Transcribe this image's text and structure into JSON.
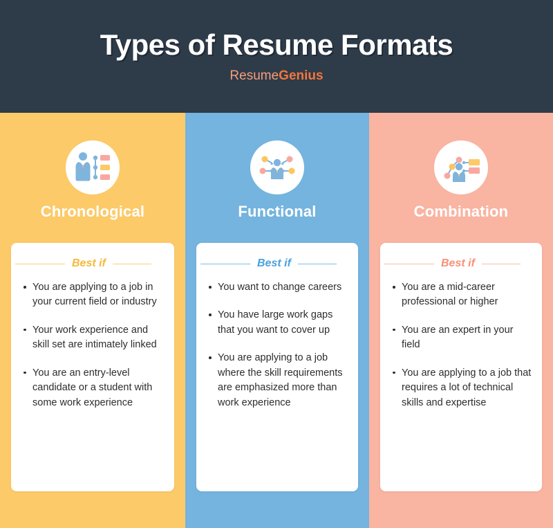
{
  "header": {
    "title": "Types of Resume Formats",
    "logo_first": "Resume",
    "logo_second": "Genius",
    "background_color": "#2e3b49",
    "logo_first_color": "#f79e78",
    "logo_second_color": "#f4763c"
  },
  "columns": [
    {
      "title": "Chronological",
      "background_color": "#fcca69",
      "accent_color": "#f7b939",
      "icon_name": "person-timeline-icon",
      "best_if_label": "Best if",
      "bullets": [
        "You are applying to a job in your current field or industry",
        "Your work experience and skill set are intimately linked",
        "You are an entry-level candidate or a student with some work experience"
      ]
    },
    {
      "title": "Functional",
      "background_color": "#74b4de",
      "accent_color": "#49a2de",
      "icon_name": "person-skills-network-icon",
      "best_if_label": "Best if",
      "bullets": [
        "You want to change careers",
        "You have large work gaps that you want to cover up",
        "You are applying to a job where the skill requirements are emphasized more than work experience"
      ]
    },
    {
      "title": "Combination",
      "background_color": "#f9b4a2",
      "accent_color": "#f99077",
      "icon_name": "person-network-timeline-icon",
      "best_if_label": "Best if",
      "bullets": [
        "You are a mid-career professional or higher",
        "You are an expert in your field",
        "You are applying to a job that requires a lot of technical skills and expertise"
      ]
    }
  ]
}
